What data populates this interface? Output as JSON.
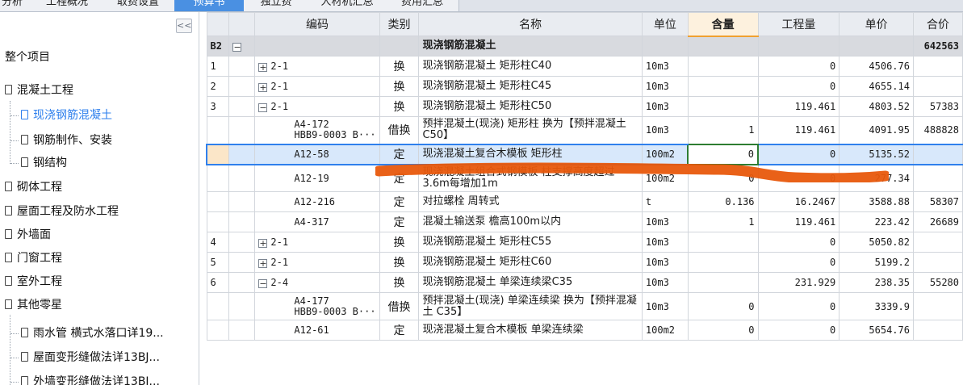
{
  "tabs": [
    {
      "label": "分析",
      "active": false
    },
    {
      "label": "工程概况",
      "active": false
    },
    {
      "label": "取费设置",
      "active": false
    },
    {
      "label": "预算书",
      "active": true
    },
    {
      "label": "独立费",
      "active": false
    },
    {
      "label": "人材机汇总",
      "active": false
    },
    {
      "label": "费用汇总",
      "active": false
    }
  ],
  "tree": {
    "collapse_label": "<<",
    "root": "整个项目",
    "nodes": [
      {
        "label": "混凝土工程",
        "level": 0
      },
      {
        "label": "现浇钢筋混凝土",
        "level": 1,
        "selected": true
      },
      {
        "label": "钢筋制作、安装",
        "level": 1
      },
      {
        "label": "钢结构",
        "level": 1
      },
      {
        "label": "砌体工程",
        "level": 0
      },
      {
        "label": "屋面工程及防水工程",
        "level": 0
      },
      {
        "label": "外墙面",
        "level": 0
      },
      {
        "label": "门窗工程",
        "level": 0
      },
      {
        "label": "室外工程",
        "level": 0
      },
      {
        "label": "其他零星",
        "level": 0
      },
      {
        "label": "雨水管 横式水落口详19...",
        "level": 1
      },
      {
        "label": "屋面变形缝做法详13BJ...",
        "level": 1
      },
      {
        "label": "外墙变形缝做法详13BJ...",
        "level": 1
      }
    ]
  },
  "grid": {
    "headers": [
      "",
      "",
      "编码",
      "类别",
      "名称",
      "单位",
      "含量",
      "工程量",
      "单价",
      "合价"
    ],
    "highlight_col": 6,
    "group": {
      "idx": "B2",
      "box": "−",
      "name": "现浇钢筋混凝土",
      "total": "642563"
    },
    "rows": [
      {
        "idx": "1",
        "box": "+",
        "code": "2-1",
        "type": "换",
        "name": "现浇钢筋混凝土 矩形柱C40",
        "unit": "10m3",
        "qty": "",
        "amount": "0",
        "price": "4506.76",
        "total": ""
      },
      {
        "idx": "2",
        "box": "+",
        "code": "2-1",
        "type": "换",
        "name": "现浇钢筋混凝土 矩形柱C45",
        "unit": "10m3",
        "qty": "",
        "amount": "0",
        "price": "4655.14",
        "total": ""
      },
      {
        "idx": "3",
        "box": "−",
        "code": "2-1",
        "type": "换",
        "name": "现浇钢筋混凝土 矩形柱C50",
        "unit": "10m3",
        "qty": "",
        "amount": "119.461",
        "price": "4803.52",
        "total": "57383"
      },
      {
        "idx": "",
        "sub": true,
        "tall": true,
        "code": "A4-172",
        "code2": "HBB9-0003 B···",
        "type": "借换",
        "name": "预拌混凝土(现浇) 矩形柱  换为【预拌混凝土 C50】",
        "unit": "10m3",
        "qty": "1",
        "amount": "119.461",
        "price": "4091.95",
        "total": "488828"
      },
      {
        "idx": "",
        "sub": true,
        "selected": true,
        "code": "A12-58",
        "type": "定",
        "name": "现浇混凝土复合木模板 矩形柱",
        "unit": "100m2",
        "qty": "0",
        "amount": "0",
        "price": "5135.52",
        "total": ""
      },
      {
        "idx": "",
        "sub": true,
        "tall": true,
        "code": "A12-19",
        "type": "定",
        "name": "现浇混凝土组合式钢模板 柱支撑高度超过3.6m每增加1m",
        "unit": "100m2",
        "qty": "0",
        "amount": "0",
        "price": "277.34",
        "total": ""
      },
      {
        "idx": "",
        "sub": true,
        "code": "A12-216",
        "type": "定",
        "name": "对拉螺栓 周转式",
        "unit": "t",
        "qty": "0.136",
        "amount": "16.2467",
        "price": "3588.88",
        "total": "58307"
      },
      {
        "idx": "",
        "sub": true,
        "code": "A4-317",
        "type": "定",
        "name": "混凝土输送泵 檐高100m以内",
        "unit": "10m3",
        "qty": "1",
        "amount": "119.461",
        "price": "223.42",
        "total": "26689"
      },
      {
        "idx": "4",
        "box": "+",
        "code": "2-1",
        "type": "换",
        "name": "现浇钢筋混凝土 矩形柱C55",
        "unit": "10m3",
        "qty": "",
        "amount": "0",
        "price": "5050.82",
        "total": ""
      },
      {
        "idx": "5",
        "box": "+",
        "code": "2-1",
        "type": "换",
        "name": "现浇钢筋混凝土 矩形柱C60",
        "unit": "10m3",
        "qty": "",
        "amount": "0",
        "price": "5199.2",
        "total": ""
      },
      {
        "idx": "6",
        "box": "−",
        "code": "2-4",
        "type": "换",
        "name": "现浇钢筋混凝土 单梁连续梁C35",
        "unit": "10m3",
        "qty": "",
        "amount": "231.929",
        "price": "238.35",
        "total": "55280"
      },
      {
        "idx": "",
        "sub": true,
        "tall": true,
        "code": "A4-177",
        "code2": "HBB9-0003 B···",
        "type": "借换",
        "name": "预拌混凝土(现浇) 单梁连续梁  换为【预拌混凝土 C35】",
        "unit": "10m3",
        "qty": "0",
        "amount": "0",
        "price": "3339.9",
        "total": ""
      },
      {
        "idx": "",
        "sub": true,
        "code": "A12-61",
        "type": "定",
        "name": "现浇混凝土复合木模板 单梁连续梁",
        "unit": "100m2",
        "qty": "0",
        "amount": "0",
        "price": "5654.76",
        "total": ""
      }
    ]
  },
  "colors": {
    "accent": "#2f80ed",
    "stroke": "#e8590c",
    "edit_border": "#2e7d32"
  }
}
